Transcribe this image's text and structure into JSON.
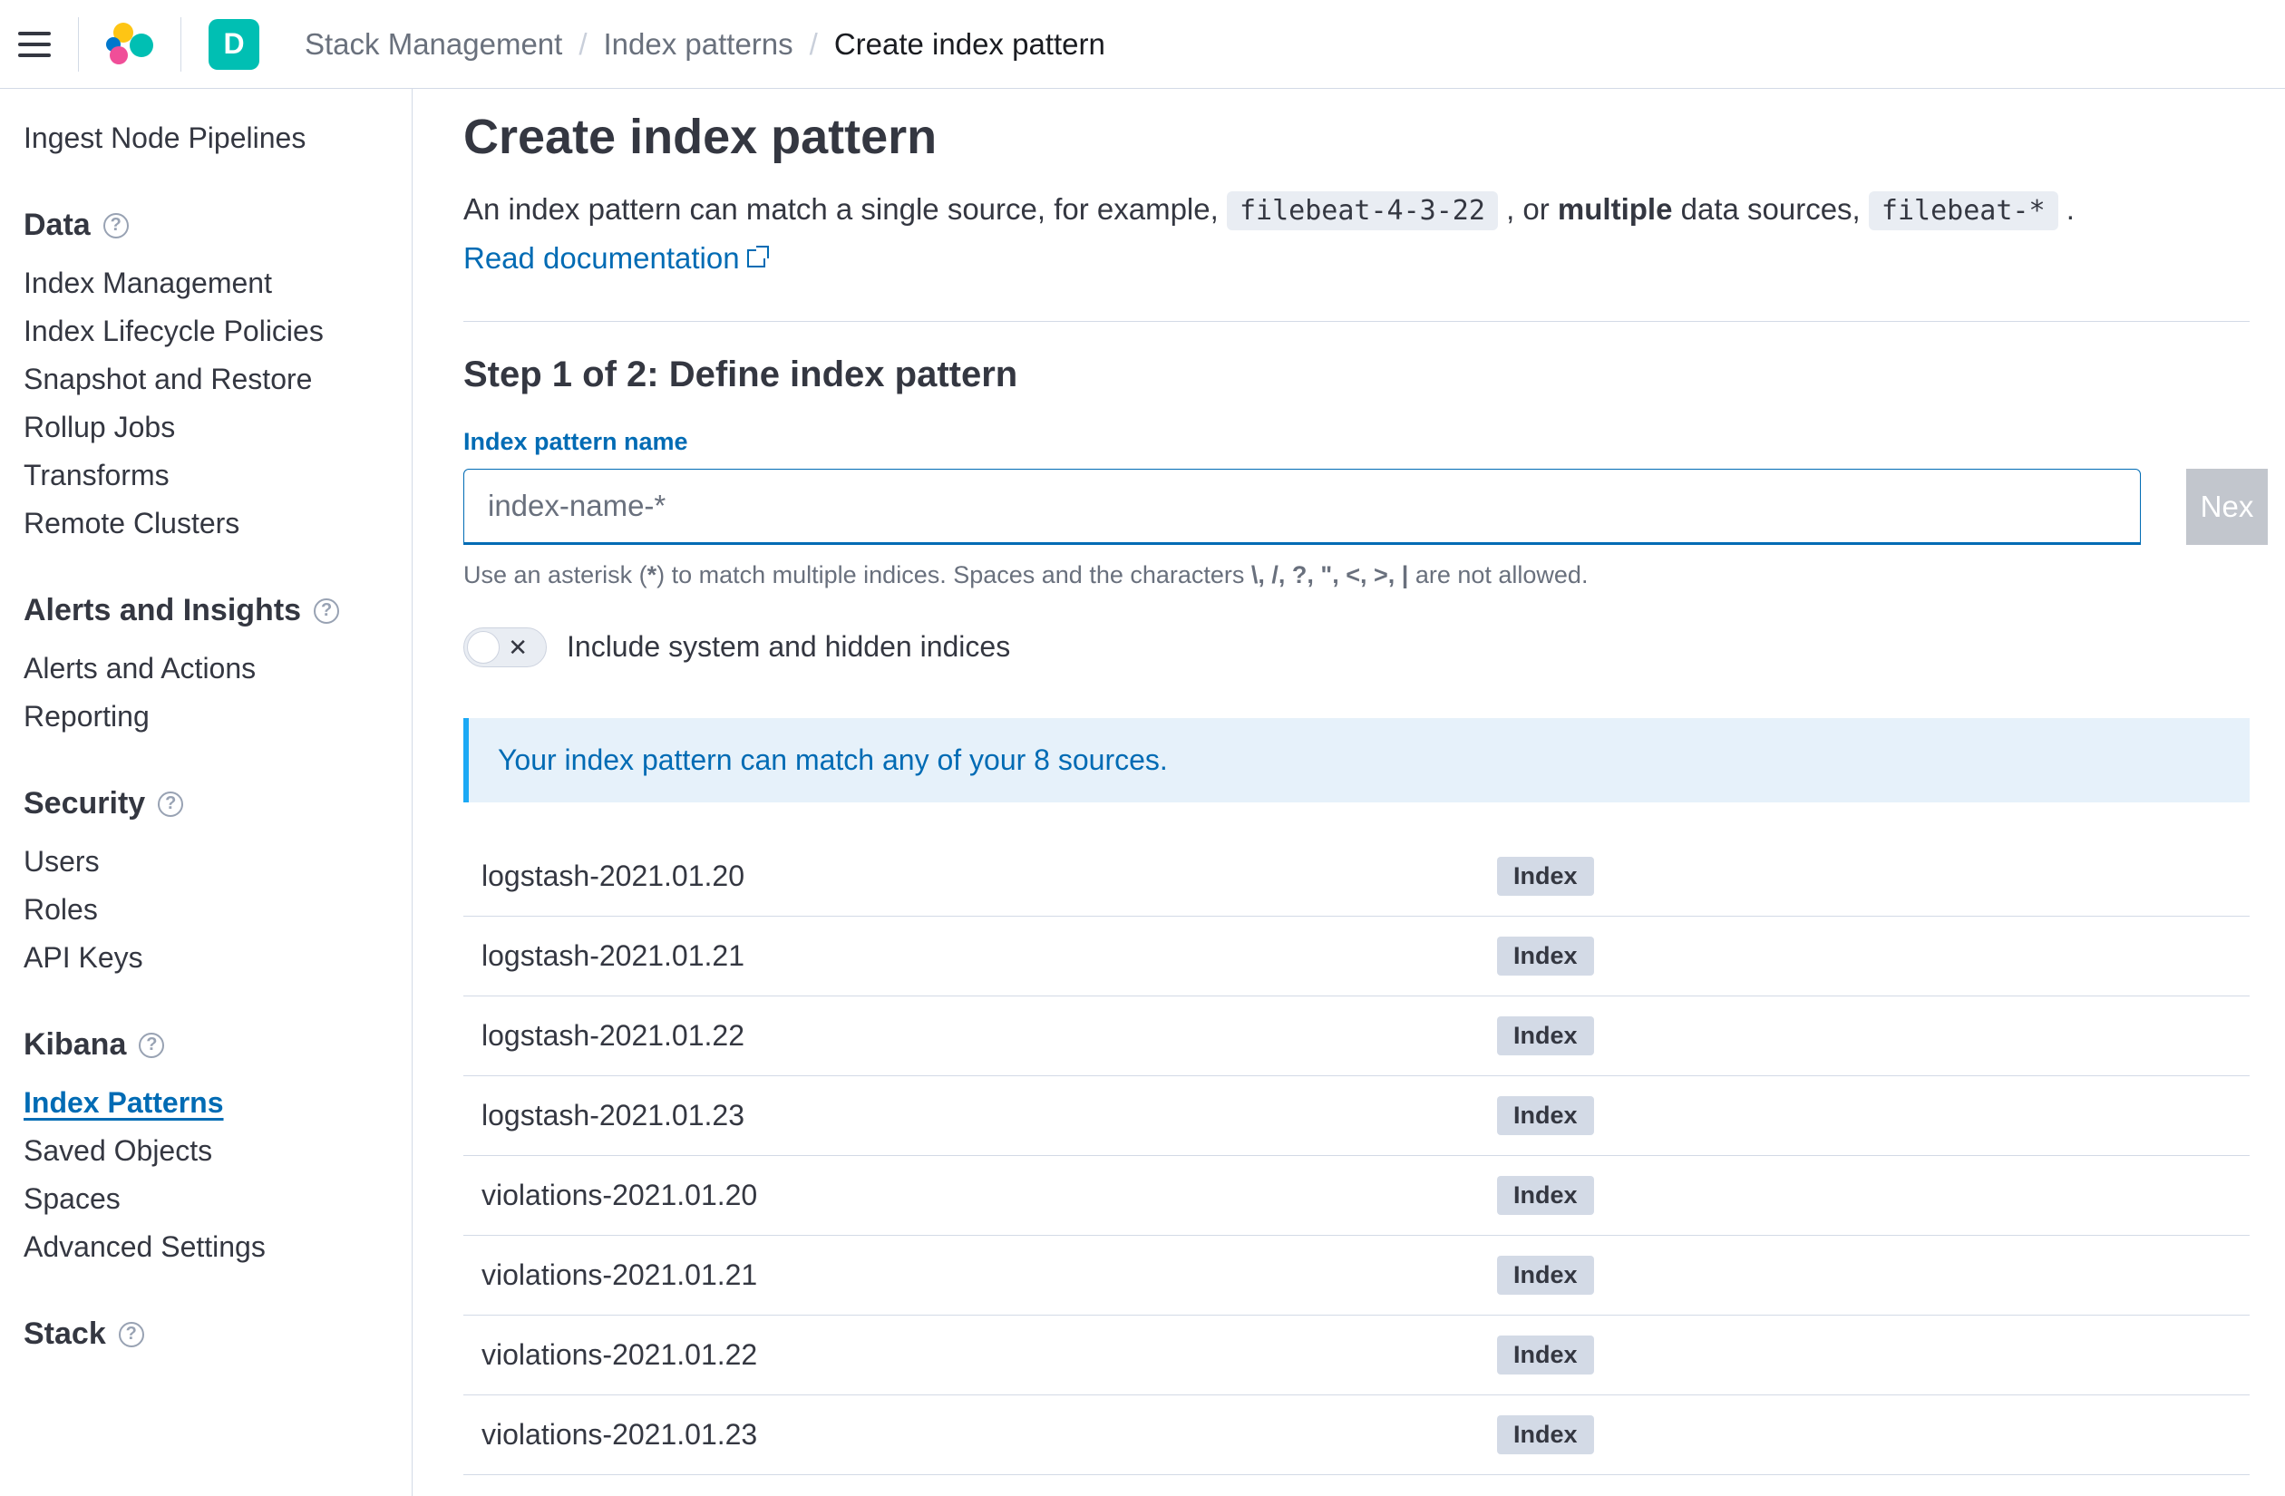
{
  "header": {
    "space_letter": "D",
    "breadcrumbs": [
      "Stack Management",
      "Index patterns",
      "Create index pattern"
    ]
  },
  "sidebar": {
    "top_link": "Ingest Node Pipelines",
    "sections": [
      {
        "title": "Data",
        "items": [
          "Index Management",
          "Index Lifecycle Policies",
          "Snapshot and Restore",
          "Rollup Jobs",
          "Transforms",
          "Remote Clusters"
        ]
      },
      {
        "title": "Alerts and Insights",
        "items": [
          "Alerts and Actions",
          "Reporting"
        ]
      },
      {
        "title": "Security",
        "items": [
          "Users",
          "Roles",
          "API Keys"
        ]
      },
      {
        "title": "Kibana",
        "items": [
          "Index Patterns",
          "Saved Objects",
          "Spaces",
          "Advanced Settings"
        ],
        "active_index": 0
      },
      {
        "title": "Stack",
        "items": []
      }
    ]
  },
  "main": {
    "title": "Create index pattern",
    "desc_prefix": "An index pattern can match a single source, for example, ",
    "code1": "filebeat-4-3-22",
    "desc_mid": " , or ",
    "desc_bold": "multiple",
    "desc_mid2": " data sources, ",
    "code2": "filebeat-*",
    "desc_suffix": " .",
    "doc_link": "Read documentation",
    "step_title": "Step 1 of 2: Define index pattern",
    "field_label": "Index pattern name",
    "placeholder": "index-name-*",
    "next_button": "Nex",
    "hint_prefix": "Use an asterisk (",
    "hint_bold1": "*",
    "hint_mid": ") to match multiple indices. Spaces and the characters ",
    "hint_bold2": "\\, /, ?, \", <, >, |",
    "hint_suffix": " are not allowed.",
    "switch_x": "✕",
    "switch_label": "Include system and hidden indices",
    "callout": "Your index pattern can match any of your 8 sources.",
    "badge_label": "Index",
    "indices": [
      "logstash-2021.01.20",
      "logstash-2021.01.21",
      "logstash-2021.01.22",
      "logstash-2021.01.23",
      "violations-2021.01.20",
      "violations-2021.01.21",
      "violations-2021.01.22",
      "violations-2021.01.23"
    ]
  }
}
